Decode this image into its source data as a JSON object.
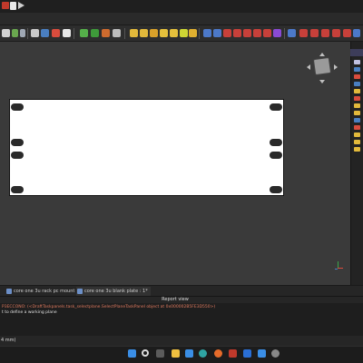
{
  "tabs": [
    {
      "label": "core one 3u rack pc mount : 1*"
    },
    {
      "label": "core one 3u blank plate : 1*"
    }
  ],
  "report_view": {
    "title": "Report view",
    "lines": [
      "P3ECCONO: (<DraftTaskpanels.task_selectplane.SelectPlaneTaskPanel object at 0x000002B5FE3D550>)",
      "t to define a working plane"
    ]
  },
  "status_bar": {
    "text": "4 mm)"
  },
  "colors": {
    "viewport_background": "#3a3a3a",
    "plate_fill": "#ffffff",
    "report_error_text": "#e07a5f",
    "report_normal_text": "#e0e0e0"
  },
  "icons": {
    "title": [
      "window-icon",
      "new-document-icon",
      "play-macro-icon"
    ],
    "toolbar": [
      "undo-icon",
      "redo-icon",
      "macro-icon",
      "cursor-icon",
      "refresh-icon",
      "stop-icon",
      "workbench-icon",
      "part-icon",
      "view-fit-icon",
      "view-isometric-icon",
      "view-front-icon",
      "view-top-icon",
      "view-right-icon",
      "measure-icon",
      "box-icon",
      "cylinder-icon",
      "sphere-icon",
      "cone-icon",
      "torus-icon",
      "union-icon",
      "cut-icon",
      "intersect-icon",
      "extrude-icon",
      "revolve-icon",
      "mirror-icon",
      "fillet-icon",
      "chamfer-icon",
      "offset-icon"
    ],
    "taskbar": [
      "windows-start-icon",
      "search-icon",
      "task-view-icon",
      "file-explorer-icon",
      "checkmark-app-icon",
      "edge-browser-icon",
      "firefox-icon",
      "freecad-icon",
      "outlook-icon",
      "mail-icon",
      "settings-icon"
    ]
  }
}
